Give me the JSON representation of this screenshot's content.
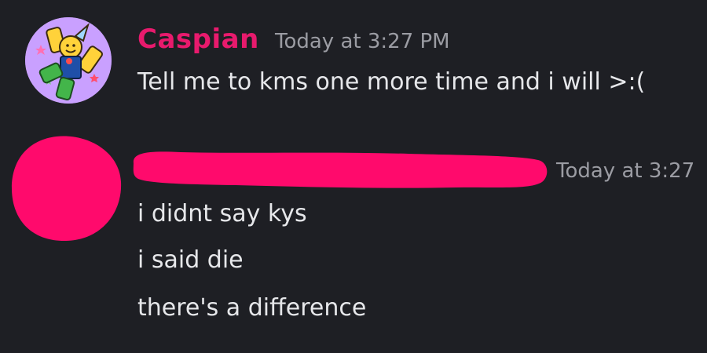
{
  "colors": {
    "background": "#1e1f24",
    "author_name": "#e81a6d",
    "timestamp": "#9b9ca3",
    "message_text": "#e6e7ea",
    "redaction": "#ff0a6c"
  },
  "messages": [
    {
      "author": "Caspian",
      "timestamp": "Today at 3:27 PM",
      "avatar_icon": "cartoon-character-avatar-icon",
      "lines": [
        "Tell me to kms one more time and i will >:("
      ]
    },
    {
      "timestamp": "Today at 3:27",
      "avatar_icon": "redacted-avatar",
      "lines": [
        "i didnt say kys",
        "i said die",
        "there's a difference"
      ]
    }
  ]
}
